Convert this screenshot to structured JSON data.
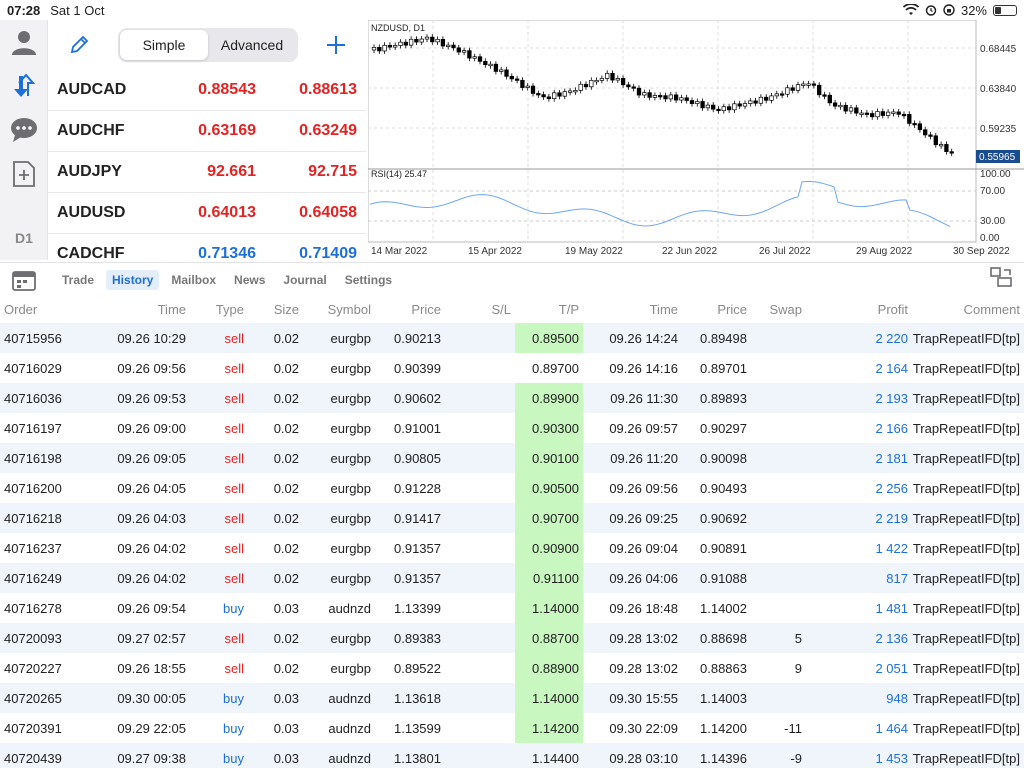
{
  "status": {
    "time": "07:28",
    "date": "Sat 1 Oct",
    "battery": "32%",
    "battery_level": 0.32
  },
  "rail": {
    "timeframe": "D1"
  },
  "segment": {
    "simple": "Simple",
    "advanced": "Advanced"
  },
  "quotes": [
    {
      "symbol": "AUDCAD",
      "bid": "0.88543",
      "ask": "0.88613",
      "color": "red"
    },
    {
      "symbol": "AUDCHF",
      "bid": "0.63169",
      "ask": "0.63249",
      "color": "red"
    },
    {
      "symbol": "AUDJPY",
      "bid": "92.661",
      "ask": "92.715",
      "color": "red"
    },
    {
      "symbol": "AUDUSD",
      "bid": "0.64013",
      "ask": "0.64058",
      "color": "red"
    },
    {
      "symbol": "CADCHF",
      "bid": "0.71346",
      "ask": "0.71409",
      "color": "blue"
    }
  ],
  "chart": {
    "title": "NZDUSD, D1",
    "price_labels": [
      "0.68445",
      "0.63840",
      "0.59235"
    ],
    "current_price": "0.55965",
    "rsi_label": "RSI(14) 25.47",
    "rsi_levels": [
      "100.00",
      "70.00",
      "30.00",
      "0.00"
    ],
    "dates": [
      "14 Mar 2022",
      "15 Apr 2022",
      "19 May 2022",
      "22 Jun 2022",
      "26 Jul 2022",
      "29 Aug 2022",
      "30 Sep 2022"
    ],
    "colors": {
      "up": "#ffffff",
      "down": "#000000",
      "rsi": "#6fa8f0",
      "current": "#1a4d8f"
    }
  },
  "tabs": [
    "Trade",
    "History",
    "Mailbox",
    "News",
    "Journal",
    "Settings"
  ],
  "active_tab": "History",
  "table": {
    "headers": {
      "order": "Order",
      "time": "Time",
      "type": "Type",
      "size": "Size",
      "symbol": "Symbol",
      "price": "Price",
      "sl": "S/L",
      "tp": "T/P",
      "time2": "Time",
      "price2": "Price",
      "swap": "Swap",
      "profit": "Profit",
      "comment": "Comment"
    },
    "rows": [
      {
        "order": "40715956",
        "time": "09.26 10:29",
        "type": "sell",
        "size": "0.02",
        "symbol": "eurgbp",
        "price": "0.90213",
        "sl": "",
        "tp": "0.89500",
        "tp_green": true,
        "time2": "09.26 14:24",
        "price2": "0.89498",
        "swap": "",
        "profit": "2 220",
        "comment": "TrapRepeatIFD[tp]"
      },
      {
        "order": "40716029",
        "time": "09.26 09:56",
        "type": "sell",
        "size": "0.02",
        "symbol": "eurgbp",
        "price": "0.90399",
        "sl": "",
        "tp": "0.89700",
        "tp_green": false,
        "time2": "09.26 14:16",
        "price2": "0.89701",
        "swap": "",
        "profit": "2 164",
        "comment": "TrapRepeatIFD[tp]"
      },
      {
        "order": "40716036",
        "time": "09.26 09:53",
        "type": "sell",
        "size": "0.02",
        "symbol": "eurgbp",
        "price": "0.90602",
        "sl": "",
        "tp": "0.89900",
        "tp_green": true,
        "time2": "09.26 11:30",
        "price2": "0.89893",
        "swap": "",
        "profit": "2 193",
        "comment": "TrapRepeatIFD[tp]"
      },
      {
        "order": "40716197",
        "time": "09.26 09:00",
        "type": "sell",
        "size": "0.02",
        "symbol": "eurgbp",
        "price": "0.91001",
        "sl": "",
        "tp": "0.90300",
        "tp_green": true,
        "time2": "09.26 09:57",
        "price2": "0.90297",
        "swap": "",
        "profit": "2 166",
        "comment": "TrapRepeatIFD[tp]"
      },
      {
        "order": "40716198",
        "time": "09.26 09:05",
        "type": "sell",
        "size": "0.02",
        "symbol": "eurgbp",
        "price": "0.90805",
        "sl": "",
        "tp": "0.90100",
        "tp_green": true,
        "time2": "09.26 11:20",
        "price2": "0.90098",
        "swap": "",
        "profit": "2 181",
        "comment": "TrapRepeatIFD[tp]"
      },
      {
        "order": "40716200",
        "time": "09.26 04:05",
        "type": "sell",
        "size": "0.02",
        "symbol": "eurgbp",
        "price": "0.91228",
        "sl": "",
        "tp": "0.90500",
        "tp_green": true,
        "time2": "09.26 09:56",
        "price2": "0.90493",
        "swap": "",
        "profit": "2 256",
        "comment": "TrapRepeatIFD[tp]"
      },
      {
        "order": "40716218",
        "time": "09.26 04:03",
        "type": "sell",
        "size": "0.02",
        "symbol": "eurgbp",
        "price": "0.91417",
        "sl": "",
        "tp": "0.90700",
        "tp_green": true,
        "time2": "09.26 09:25",
        "price2": "0.90692",
        "swap": "",
        "profit": "2 219",
        "comment": "TrapRepeatIFD[tp]"
      },
      {
        "order": "40716237",
        "time": "09.26 04:02",
        "type": "sell",
        "size": "0.02",
        "symbol": "eurgbp",
        "price": "0.91357",
        "sl": "",
        "tp": "0.90900",
        "tp_green": true,
        "time2": "09.26 09:04",
        "price2": "0.90891",
        "swap": "",
        "profit": "1 422",
        "comment": "TrapRepeatIFD[tp]"
      },
      {
        "order": "40716249",
        "time": "09.26 04:02",
        "type": "sell",
        "size": "0.02",
        "symbol": "eurgbp",
        "price": "0.91357",
        "sl": "",
        "tp": "0.91100",
        "tp_green": true,
        "time2": "09.26 04:06",
        "price2": "0.91088",
        "swap": "",
        "profit": "817",
        "comment": "TrapRepeatIFD[tp]"
      },
      {
        "order": "40716278",
        "time": "09.26 09:54",
        "type": "buy",
        "size": "0.03",
        "symbol": "audnzd",
        "price": "1.13399",
        "sl": "",
        "tp": "1.14000",
        "tp_green": true,
        "time2": "09.26 18:48",
        "price2": "1.14002",
        "swap": "",
        "profit": "1 481",
        "comment": "TrapRepeatIFD[tp]"
      },
      {
        "order": "40720093",
        "time": "09.27 02:57",
        "type": "sell",
        "size": "0.02",
        "symbol": "eurgbp",
        "price": "0.89383",
        "sl": "",
        "tp": "0.88700",
        "tp_green": true,
        "time2": "09.28 13:02",
        "price2": "0.88698",
        "swap": "5",
        "profit": "2 136",
        "comment": "TrapRepeatIFD[tp]"
      },
      {
        "order": "40720227",
        "time": "09.26 18:55",
        "type": "sell",
        "size": "0.02",
        "symbol": "eurgbp",
        "price": "0.89522",
        "sl": "",
        "tp": "0.88900",
        "tp_green": true,
        "time2": "09.28 13:02",
        "price2": "0.88863",
        "swap": "9",
        "profit": "2 051",
        "comment": "TrapRepeatIFD[tp]"
      },
      {
        "order": "40720265",
        "time": "09.30 00:05",
        "type": "buy",
        "size": "0.03",
        "symbol": "audnzd",
        "price": "1.13618",
        "sl": "",
        "tp": "1.14000",
        "tp_green": true,
        "time2": "09.30 15:55",
        "price2": "1.14003",
        "swap": "",
        "profit": "948",
        "comment": "TrapRepeatIFD[tp]"
      },
      {
        "order": "40720391",
        "time": "09.29 22:05",
        "type": "buy",
        "size": "0.03",
        "symbol": "audnzd",
        "price": "1.13599",
        "sl": "",
        "tp": "1.14200",
        "tp_green": true,
        "time2": "09.30 22:09",
        "price2": "1.14200",
        "swap": "-11",
        "profit": "1 464",
        "comment": "TrapRepeatIFD[tp]"
      },
      {
        "order": "40720439",
        "time": "09.27 09:38",
        "type": "buy",
        "size": "0.03",
        "symbol": "audnzd",
        "price": "1.13801",
        "sl": "",
        "tp": "1.14400",
        "tp_green": false,
        "time2": "09.28 03:10",
        "price2": "1.14396",
        "swap": "-9",
        "profit": "1 453",
        "comment": "TrapRepeatIFD[tp]"
      }
    ]
  }
}
